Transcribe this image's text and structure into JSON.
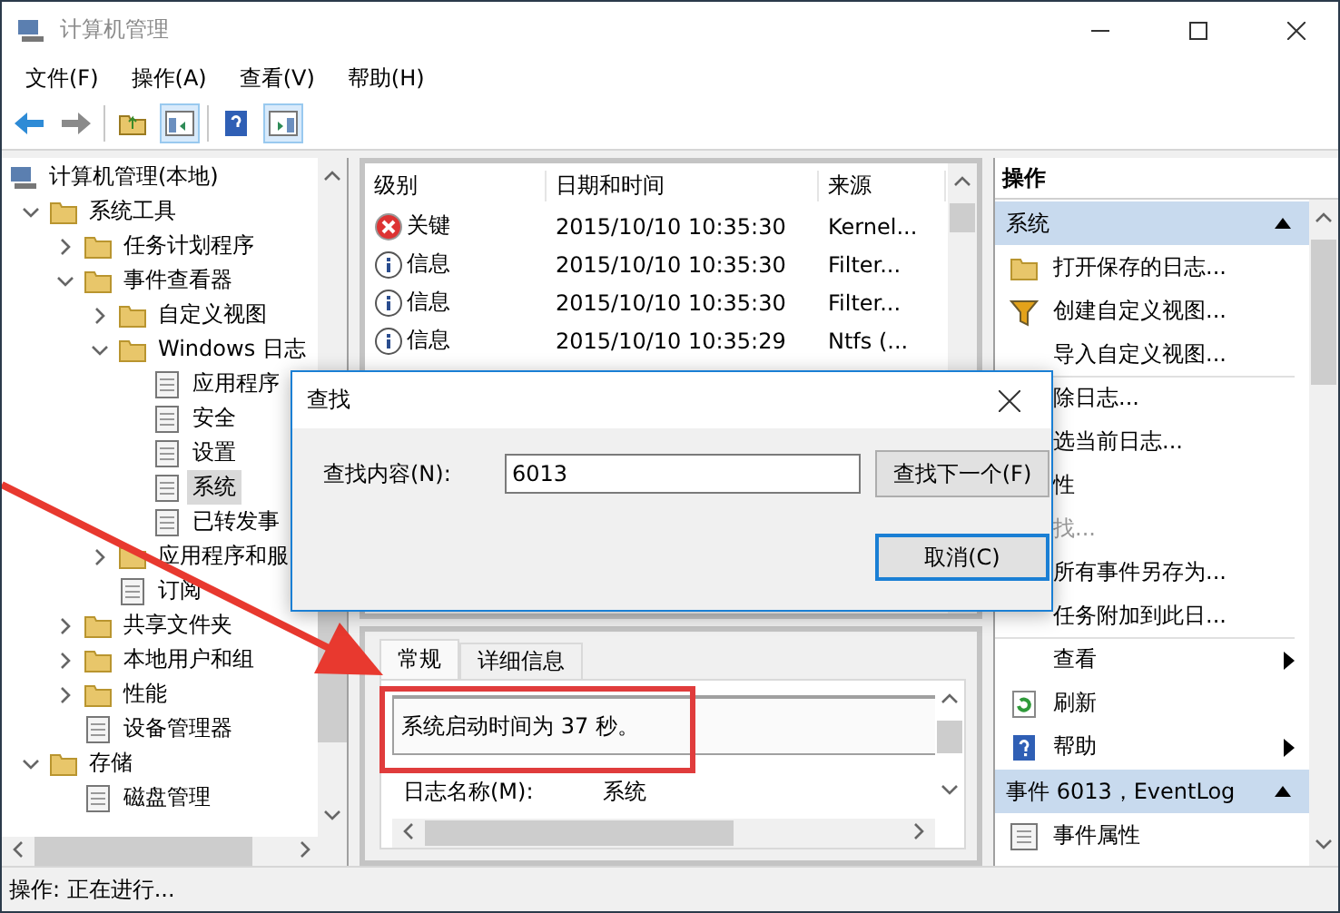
{
  "window": {
    "title": "计算机管理"
  },
  "menu": [
    "文件(F)",
    "操作(A)",
    "查看(V)",
    "帮助(H)"
  ],
  "tree": {
    "items": [
      {
        "label": "计算机管理(本地)",
        "selected": false,
        "children": [
          {
            "label": "系统工具",
            "expanded": true,
            "selected": false,
            "children": [
              {
                "label": "任务计划程序",
                "expanded": false,
                "selected": false
              },
              {
                "label": "事件查看器",
                "expanded": true,
                "selected": false,
                "children": [
                  {
                    "label": "自定义视图",
                    "expanded": false,
                    "selected": false
                  },
                  {
                    "label": "Windows 日志",
                    "expanded": true,
                    "selected": false,
                    "children": [
                      {
                        "label": "应用程序",
                        "selected": false
                      },
                      {
                        "label": "安全",
                        "selected": false
                      },
                      {
                        "label": "设置",
                        "selected": false
                      },
                      {
                        "label": "系统",
                        "selected": true
                      },
                      {
                        "label": "已转发事",
                        "selected": false
                      }
                    ]
                  },
                  {
                    "label": "应用程序和服",
                    "expanded": false,
                    "selected": false
                  },
                  {
                    "label": "订阅",
                    "selected": false
                  }
                ]
              },
              {
                "label": "共享文件夹",
                "expanded": false,
                "selected": false
              },
              {
                "label": "本地用户和组",
                "expanded": false,
                "selected": false
              },
              {
                "label": "性能",
                "expanded": false,
                "selected": false
              },
              {
                "label": "设备管理器",
                "selected": false
              }
            ]
          },
          {
            "label": "存储",
            "expanded": true,
            "selected": false,
            "children": [
              {
                "label": "磁盘管理",
                "selected": false
              }
            ]
          }
        ]
      }
    ]
  },
  "events": {
    "columns": [
      "级别",
      "日期和时间",
      "来源"
    ],
    "rows": [
      {
        "kind": "error",
        "level": "关键",
        "date": "2015/10/10 10:35:30",
        "source": "Kernel..."
      },
      {
        "kind": "info",
        "level": "信息",
        "date": "2015/10/10 10:35:30",
        "source": "Filter..."
      },
      {
        "kind": "info",
        "level": "信息",
        "date": "2015/10/10 10:35:30",
        "source": "Filter..."
      },
      {
        "kind": "info",
        "level": "信息",
        "date": "2015/10/10 10:35:29",
        "source": "Ntfs (..."
      }
    ]
  },
  "detail": {
    "tabs": [
      {
        "label": "常规",
        "selected": true
      },
      {
        "label": "详细信息",
        "selected": false
      }
    ],
    "description": "系统启动时间为 37 秒。",
    "fields": [
      {
        "label": "日志名称(M):",
        "value": "系统"
      }
    ]
  },
  "actions": {
    "title": "操作",
    "sections": [
      {
        "title": "系统",
        "expanded": true,
        "items": [
          {
            "label": "打开保存的日志...",
            "kind": "folder",
            "disabled": false
          },
          {
            "label": "创建自定义视图...",
            "kind": "filter",
            "disabled": false
          },
          {
            "label": "导入自定义视图...",
            "kind": "plain",
            "disabled": false
          },
          {
            "label": "除日志...",
            "kind": "plain",
            "disabled": false,
            "divider": true
          },
          {
            "label": "选当前日志...",
            "kind": "plain",
            "disabled": false
          },
          {
            "label": "性",
            "kind": "plain",
            "disabled": false
          },
          {
            "label": "找...",
            "kind": "plain",
            "disabled": true
          },
          {
            "label": "所有事件另存为...",
            "kind": "plain",
            "disabled": false
          },
          {
            "label": "任务附加到此日...",
            "kind": "plain",
            "disabled": false
          },
          {
            "label": "查看",
            "kind": "plain",
            "disabled": false,
            "divider": true,
            "submenu": true
          },
          {
            "label": "刷新",
            "kind": "refresh",
            "disabled": false
          },
          {
            "label": "帮助",
            "kind": "help",
            "disabled": false,
            "submenu": true
          }
        ]
      },
      {
        "title": "事件 6013，EventLog",
        "expanded": true,
        "items": [
          {
            "label": "事件属性",
            "kind": "properties",
            "disabled": false
          }
        ]
      }
    ]
  },
  "dialog": {
    "title": "查找",
    "label": "查找内容(N):",
    "value": "6013",
    "buttons": [
      {
        "label": "查找下一个(F)",
        "default": false
      },
      {
        "label": "取消(C)",
        "default": true
      }
    ]
  },
  "status_bar": "操作: 正在进行..."
}
